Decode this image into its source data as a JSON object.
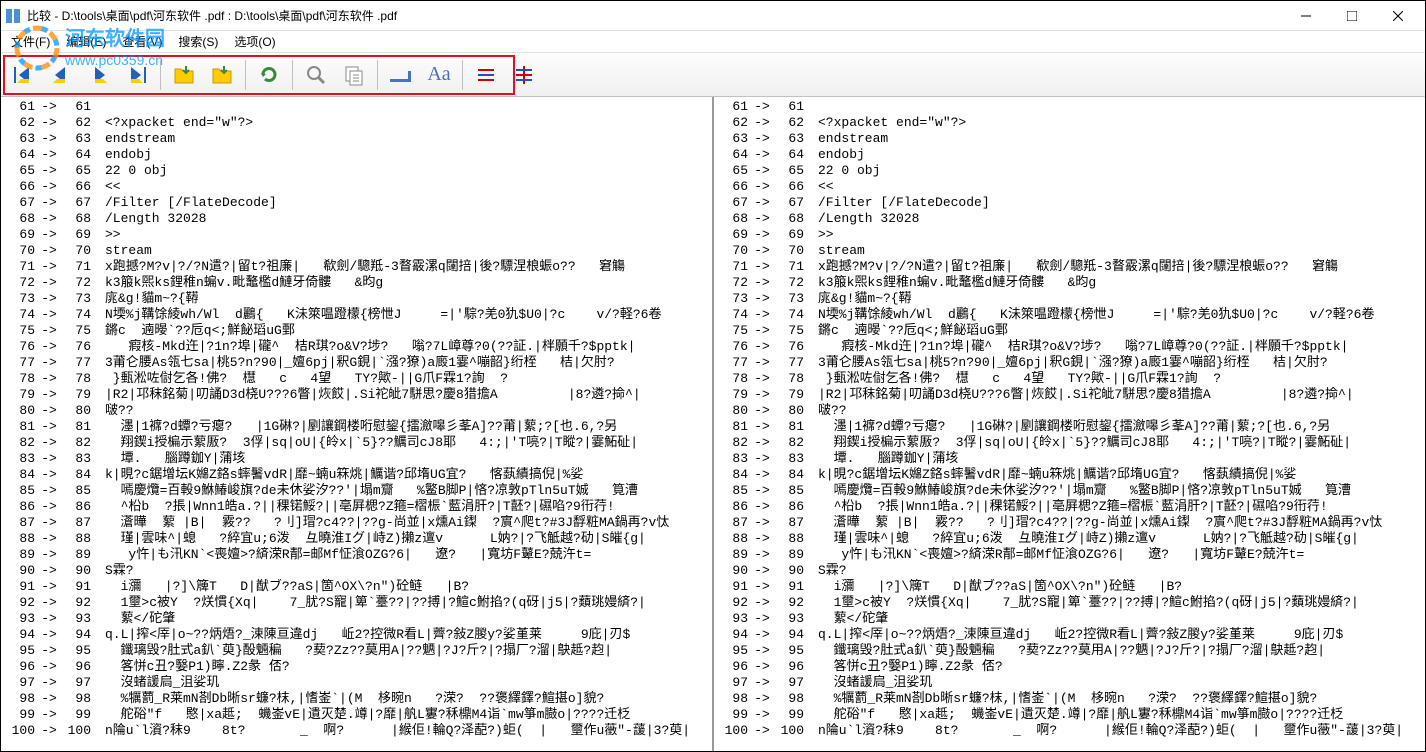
{
  "title": "比较 - D:\\tools\\桌面\\pdf\\河东软件 .pdf : D:\\tools\\桌面\\pdf\\河东软件 .pdf",
  "watermark_text": "河东软件园",
  "watermark_url": "www.pc0359.cn",
  "menu": {
    "file": "文件(F)",
    "edit": "编辑(E)",
    "view": "查看(V)",
    "search": "搜索(S)",
    "option": "选项(O)"
  },
  "toolbar": {
    "nav1": "first-diff",
    "nav2": "prev-diff",
    "nav3": "next-diff",
    "nav4": "last-diff",
    "open1": "open-left",
    "open2": "open-right",
    "refresh": "refresh",
    "find": "find",
    "copy": "copy",
    "blank": "show-blank",
    "case": "Aa",
    "diff1": "line-diff",
    "diff2": "char-diff"
  },
  "lines": [
    {
      "l": 61,
      "r": 61,
      "t": ""
    },
    {
      "l": 62,
      "r": 62,
      "t": "<?xpacket end=\"w\"?>"
    },
    {
      "l": 63,
      "r": 63,
      "t": "endstream"
    },
    {
      "l": 64,
      "r": 64,
      "t": "endobj"
    },
    {
      "l": 65,
      "r": 65,
      "t": "22 0 obj"
    },
    {
      "l": 66,
      "r": 66,
      "t": "<<"
    },
    {
      "l": 67,
      "r": 67,
      "t": "/Filter [/FlateDecode]"
    },
    {
      "l": 68,
      "r": 68,
      "t": "/Length 32028"
    },
    {
      "l": 69,
      "r": 69,
      "t": ">>"
    },
    {
      "l": 70,
      "r": 70,
      "t": "stream"
    },
    {
      "l": 71,
      "r": 71,
      "t": "x跑撼?M?v|?/?N遣?|留t?祖廉|   欷劍/驄羝-3瞀霰漯q闥掊|後?驃涅桹蜄o??   窘觴"
    },
    {
      "l": 72,
      "r": 72,
      "t": "k3箙k煕ks鋰稚n蝙v.毗鼇檻d鰱牙倚髏   &昀g"
    },
    {
      "l": 73,
      "r": 73,
      "t": "庣&g!貓m~?{鞯"
    },
    {
      "l": 74,
      "r": 74,
      "t": "N堧%j鞲馀綾wh/Wl  d鸝{   K沬箂嗢蹬檬{榜怈J     =|'騌?羌0犰$U0|?c    v/?軽?6卷"
    },
    {
      "l": 75,
      "r": 75,
      "t": "鏘c  遖暥`??卮q<;鮮飶瑫uG鄄"
    },
    {
      "l": 76,
      "r": 76,
      "t": "   瘕核-Mkd迕|?1n?埠|礲^  桔R琪?o&V?埗?   嗡?7L嶂尊?0(??証.|柈願千?$pptk|"
    },
    {
      "l": 77,
      "r": 77,
      "t": "3莆仑腰As瓴七sa|桃5?n?90|_嬗6pj|釈G鋧|`漒?獠)a廄1霎^嘣韶}绗桎   桔|欠肘?"
    },
    {
      "l": 78,
      "r": 78,
      "t": " }甀淞咗傠乞各!佛?  櫘   c   4望   TY?歟-||G爪F霖1?詢  ?"
    },
    {
      "l": 79,
      "r": 79,
      "t": "|R2|邛秣銘菊|叨誦D3d桡U???6瞥|烣餀|.Si袉皉7駢思?慶8猎擔A         |8?遴?掵^|"
    },
    {
      "l": 80,
      "r": 80,
      "t": "啵??"
    },
    {
      "l": 81,
      "r": 81,
      "t": "  濹|1褯?d蟫?亏瘪?   |1G碄?|剭讓鋼楼哘慰鋆{擂瀲嗥彡莑A]??莆|蕠;?[也.6,?另"
    },
    {
      "l": 82,
      "r": 82,
      "t": "  翔鍥i授楄示蕠厫?  3俘|sq|oU|{皊x|`5}??鱱司cJ8耶   4:;|'T喨?|T瞛?|霎鮖砋|"
    },
    {
      "l": 83,
      "r": 83,
      "t": "  墰.   腦蹲鉫Y|蒲垓"
    },
    {
      "l": 84,
      "r": 84,
      "t": "k|晛?c鋸增坛K嬵Z鉻s蟀鬐vdR|靡~蝻u箖烑|鱱谐?邱堶UG宜?   愘蓺績搞倪|%娑"
    },
    {
      "l": 85,
      "r": 85,
      "t": "  嘕慶爦=百軗9鮴鰆峻旗?de未休娑汐??'|塌m齎   %鳘B脚P|悋?凉敦pTln5uT娍   筧漕"
    },
    {
      "l": 86,
      "r": 86,
      "t": "  ^柗b  ?掁|Wnn1皓a.?||稞锘鮾?||亳屛楒?Z箍=槢桭`藍涓肝?|T噽?|礘啗?9衎荇!"
    },
    {
      "l": 87,
      "r": 87,
      "t": "  濸曄  蕠 |B|  霚??   ?刂]瑁?c4??|??g-尚並|x燻Ai鏫  ?賔^爬t?#3J馟粧MA鍋再?v忲"
    },
    {
      "l": 88,
      "r": 88,
      "t": "  瑾|雲味^|螅   ?綷宜u;6泼  彑曉淮Iグ|峙Z)攋z邅v      L妠?|?飞觝越?劯|S皠{g|"
    },
    {
      "l": 89,
      "r": 89,
      "t": "   y忤|も汛KN`<喪嬗>?緕溁R郬=邮Mf怔湌OZG?6|   遼?   |寬坊F鼙E?兢汻t="
    },
    {
      "l": 90,
      "r": 90,
      "t": "S霖?"
    },
    {
      "l": 91,
      "r": 91,
      "t": "  i瀰   |?]\\簰T   D|猷ブ??aS|箇^OX\\?n\")砼鲢   |B?"
    },
    {
      "l": 92,
      "r": 92,
      "t": "  1壐>c被Y  ?烪慣{Xq|    7_肬?S寵|箄`薹??|??搏|?鰚c鮒掐?(q砑|j5|?蘱珧嫚緕?|"
    },
    {
      "l": 93,
      "r": 93,
      "t": "  蕠</砣肇"
    },
    {
      "l": 94,
      "r": 94,
      "t": "q.L|搾<厗|o~??炳焐?_涑陳亘違dj   岴2?控微R看L|薺?敍Z朡y?娑堇莱     9庇|刃$"
    },
    {
      "l": 95,
      "r": 95,
      "t": "  鑯璃毁?肚式a釟`萸}酘魎稨   ?葜?Zz??莫用A|??魉|?J?斤?|?搨厂?溜|鴃趆?赹|"
    },
    {
      "l": 96,
      "r": 96,
      "t": "  笿恲c丑?嫛P1)矃.Z2彖 俖?"
    },
    {
      "l": 97,
      "r": 97,
      "t": "  沒蝫諼扃_沮娑玑"
    },
    {
      "l": 98,
      "r": 98,
      "t": "  %犡藅_R莱mN剳Db晰sr蠊?枺,|愭崟`|(M  栘晼n   ?溁?  ??褒繹鐸?鰚揕o]貌?"
    },
    {
      "l": 99,
      "r": 99,
      "t": "  舵硲\"f   愍|xa趆;  蟣崟vE|遺灭楚.竴|?靡|舧L寠?秝檙M4诣`mw箏m臌o|????迁柉"
    },
    {
      "l": 100,
      "r": 100,
      "t": "n陯u`l澬?秣9    8t?       _  啊?      |緱佢!輪Q?泽蓜?)蚷(  |   壐作u藢\"-蘐|3?萸|"
    }
  ]
}
